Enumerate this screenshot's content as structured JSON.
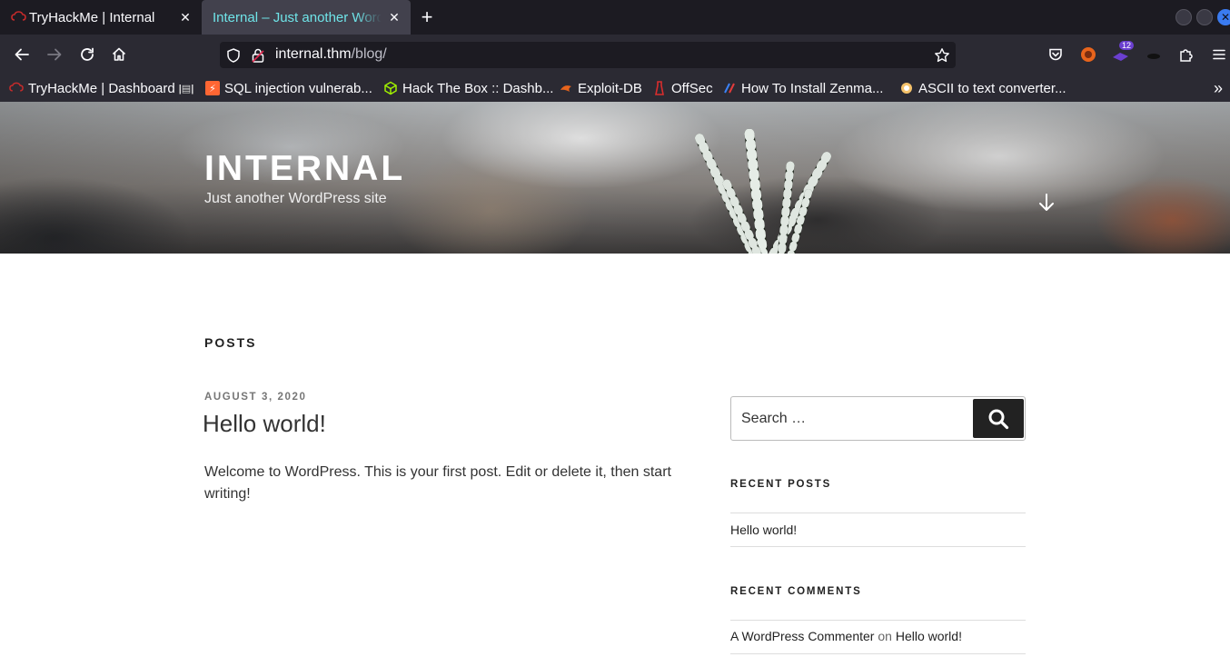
{
  "browser": {
    "tabs": [
      {
        "title": "TryHackMe | Internal",
        "active": false
      },
      {
        "title": "Internal – Just another WordPress site",
        "active": true
      }
    ],
    "url": {
      "host": "internal.thm",
      "path": "/blog/"
    },
    "extension_badge": "12",
    "bookmarks": [
      {
        "label": "TryHackMe | Dashboard",
        "icon": "tryhackme-icon"
      },
      {
        "label": "",
        "icon": "clipboard-icon"
      },
      {
        "label": "SQL injection vulnerab...",
        "icon": "portswigger-icon"
      },
      {
        "label": "Hack The Box :: Dashb...",
        "icon": "hackthebox-icon"
      },
      {
        "label": "Exploit-DB",
        "icon": "exploitdb-icon"
      },
      {
        "label": "OffSec",
        "icon": "offsec-icon"
      },
      {
        "label": "How To Install Zenma...",
        "icon": "zenmap-icon"
      },
      {
        "label": "ASCII to text converter...",
        "icon": "ascii-icon"
      }
    ]
  },
  "site": {
    "title": "INTERNAL",
    "description": "Just another WordPress site"
  },
  "main": {
    "heading": "POSTS",
    "post": {
      "date": "AUGUST 3, 2020",
      "title": "Hello world!",
      "body": "Welcome to WordPress. This is your first post. Edit or delete it, then start writing!"
    }
  },
  "sidebar": {
    "search": {
      "placeholder": "Search …"
    },
    "recent_posts": {
      "title": "RECENT POSTS",
      "items": [
        "Hello world!"
      ]
    },
    "recent_comments": {
      "title": "RECENT COMMENTS",
      "items": [
        {
          "author": "A WordPress Commenter",
          "on": "on",
          "post": "Hello world!"
        }
      ]
    }
  },
  "colors": {
    "accent_tab": "#6fe4e8",
    "chrome": "#2b2a33",
    "tabbar": "#1c1b22"
  }
}
